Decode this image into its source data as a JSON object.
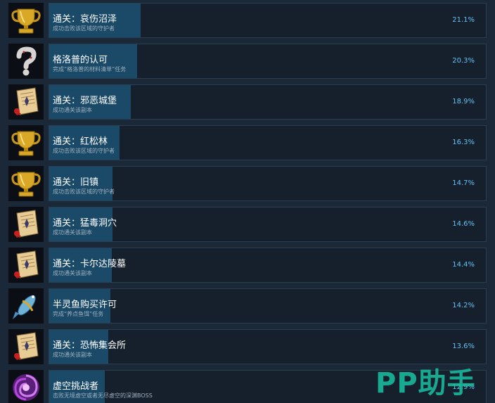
{
  "achievements": [
    {
      "icon": "trophy-icon",
      "title": "通关：哀伤沼泽",
      "desc": "成功击败该区域的守护者",
      "percent_label": "21.1%",
      "percent": 21.1
    },
    {
      "icon": "question-mark-icon",
      "title": "格洛普的认可",
      "desc": "完成“格洛普的材料清单”任务",
      "percent_label": "20.3%",
      "percent": 20.3
    },
    {
      "icon": "scroll-icon",
      "title": "通关：邪恶城堡",
      "desc": "成功通关该副本",
      "percent_label": "18.9%",
      "percent": 18.9
    },
    {
      "icon": "trophy-icon",
      "title": "通关：红松林",
      "desc": "成功击败该区域的守护者",
      "percent_label": "16.3%",
      "percent": 16.3
    },
    {
      "icon": "trophy-icon",
      "title": "通关：旧镇",
      "desc": "成功击败该区域的守护者",
      "percent_label": "14.7%",
      "percent": 14.7
    },
    {
      "icon": "scroll-icon",
      "title": "通关：猛毒洞穴",
      "desc": "成功通关该副本",
      "percent_label": "14.6%",
      "percent": 14.6
    },
    {
      "icon": "scroll-icon",
      "title": "通关：卡尔达陵墓",
      "desc": "成功通关该副本",
      "percent_label": "14.4%",
      "percent": 14.4
    },
    {
      "icon": "fish-icon",
      "title": "半灵鱼购买许可",
      "desc": "完成“养点鱼饵”任务",
      "percent_label": "14.2%",
      "percent": 14.2
    },
    {
      "icon": "scroll-icon",
      "title": "通关：恐怖集会所",
      "desc": "成功通关该副本",
      "percent_label": "13.6%",
      "percent": 13.6
    },
    {
      "icon": "void-vortex-icon",
      "title": "虚空挑战者",
      "desc": "击败无境虚空或者无尽虚空的深渊BOSS",
      "percent_label": "12.9%",
      "percent": 12.9
    }
  ],
  "watermark": "PP助手",
  "colors": {
    "background": "#1b2838",
    "fill": "#1a4a68",
    "percent_text": "#66c0f4",
    "watermark": "#19c3a3"
  }
}
